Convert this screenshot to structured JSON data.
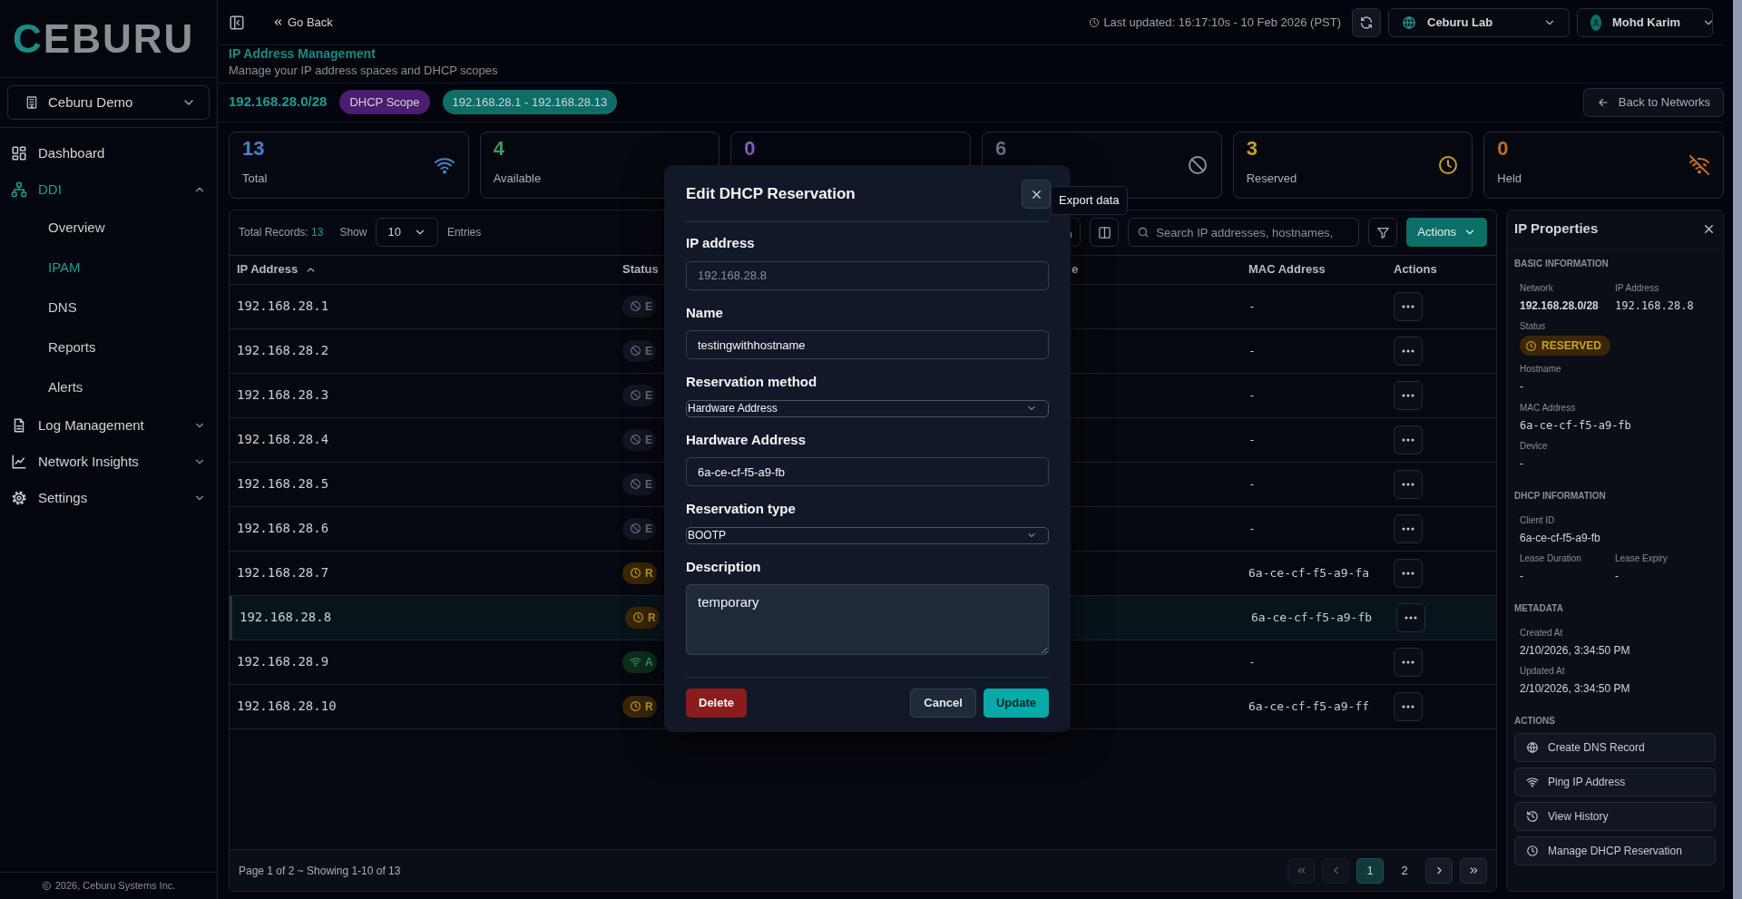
{
  "sidebar": {
    "logo": "CEBURU",
    "workspace": "Ceburu Demo",
    "nav": [
      {
        "kind": "link",
        "label": "Dashboard",
        "selected": false
      },
      {
        "kind": "group",
        "label": "DDI",
        "selected": true,
        "expanded": true,
        "children": [
          {
            "label": "Overview",
            "selected": false
          },
          {
            "label": "IPAM",
            "selected": true
          },
          {
            "label": "DNS",
            "selected": false
          },
          {
            "label": "Reports",
            "selected": false
          },
          {
            "label": "Alerts",
            "selected": false
          }
        ]
      },
      {
        "kind": "group",
        "label": "Log Management",
        "selected": false,
        "expanded": false
      },
      {
        "kind": "group",
        "label": "Network Insights",
        "selected": false,
        "expanded": false
      },
      {
        "kind": "group",
        "label": "Settings",
        "selected": false,
        "expanded": false
      }
    ],
    "footer": "2026, Ceburu Systems Inc."
  },
  "topbar": {
    "back": "Go Back",
    "last_updated": "Last updated: 16:17:10s - 10 Feb 2026 (PST)",
    "org": "Ceburu Lab",
    "user": "Mohd Karim"
  },
  "page": {
    "title": "IP Address Management",
    "subtitle": "Manage your IP address spaces and DHCP scopes"
  },
  "network": {
    "cidr": "192.168.28.0/28",
    "tags": [
      {
        "label": "DHCP Scope",
        "color": "#4a1d6e"
      },
      {
        "label": "192.168.28.1 - 192.168.28.13",
        "color": "#0d6e68"
      }
    ],
    "back_button": "Back to Networks"
  },
  "stats": [
    {
      "value": "13",
      "label": "Total",
      "color": "#4a80c8"
    },
    {
      "value": "4",
      "label": "Available",
      "color": "#3a9a63"
    },
    {
      "value": "0",
      "color": "#8b5cc6"
    },
    {
      "value": "6",
      "color": "#6b7280"
    },
    {
      "value": "3",
      "label": "Reserved",
      "color": "#c9a227"
    },
    {
      "value": "0",
      "label": "Held",
      "color": "#c06a28"
    }
  ],
  "table": {
    "total_label": "Total Records:",
    "total": "13",
    "show_label": "Show",
    "page_size": "10",
    "entries_label": "Entries",
    "search_placeholder": "Search IP addresses, hostnames,",
    "actions_button": "Actions",
    "columns": [
      "IP Address",
      "Status",
      "e",
      "MAC Address",
      "Actions"
    ],
    "rows": [
      {
        "ip": "192.168.28.1",
        "kind": "excluded",
        "status": "E",
        "mac": "-",
        "selected": false
      },
      {
        "ip": "192.168.28.2",
        "kind": "excluded",
        "status": "E",
        "mac": "-",
        "selected": false
      },
      {
        "ip": "192.168.28.3",
        "kind": "excluded",
        "status": "E",
        "mac": "-",
        "selected": false
      },
      {
        "ip": "192.168.28.4",
        "kind": "excluded",
        "status": "E",
        "mac": "-",
        "selected": false
      },
      {
        "ip": "192.168.28.5",
        "kind": "excluded",
        "status": "E",
        "mac": "-",
        "selected": false
      },
      {
        "ip": "192.168.28.6",
        "kind": "excluded",
        "status": "E",
        "mac": "-",
        "selected": false
      },
      {
        "ip": "192.168.28.7",
        "kind": "reserved",
        "status": "R",
        "mac": "6a-ce-cf-f5-a9-fa",
        "selected": false
      },
      {
        "ip": "192.168.28.8",
        "kind": "reserved",
        "status": "R",
        "mac": "6a-ce-cf-f5-a9-fb",
        "selected": true
      },
      {
        "ip": "192.168.28.9",
        "kind": "available",
        "status": "A",
        "mac": "-",
        "selected": false
      },
      {
        "ip": "192.168.28.10",
        "kind": "reserved",
        "status": "R",
        "mac": "6a-ce-cf-f5-a9-ff",
        "selected": false
      }
    ],
    "footer": "Page 1 of 2 ~ Showing 1-10 of 13",
    "pager": [
      {
        "kind": "first",
        "disabled": true,
        "selected": false
      },
      {
        "kind": "prev",
        "disabled": true,
        "selected": false
      },
      {
        "kind": "page",
        "label": "1",
        "disabled": false,
        "selected": true
      },
      {
        "kind": "page",
        "label": "2",
        "disabled": false,
        "selected": false
      },
      {
        "kind": "next",
        "disabled": false,
        "selected": false
      },
      {
        "kind": "last",
        "disabled": false,
        "selected": false
      }
    ]
  },
  "properties": {
    "title": "IP Properties",
    "sections": [
      {
        "heading": "BASIC INFORMATION",
        "rows": [
          [
            {
              "label": "Network",
              "value": "192.168.28.0/28",
              "kind": "bold"
            },
            {
              "label": "IP Address",
              "value": "192.168.28.8",
              "kind": "mono"
            }
          ],
          [
            {
              "label": "Status",
              "value": "RESERVED",
              "kind": "badge"
            }
          ],
          [
            {
              "label": "Hostname",
              "value": "-",
              "kind": "text"
            }
          ],
          [
            {
              "label": "MAC Address",
              "value": "6a-ce-cf-f5-a9-fb",
              "kind": "mono"
            }
          ],
          [
            {
              "label": "Device",
              "value": "-",
              "kind": "text"
            }
          ]
        ]
      },
      {
        "heading": "DHCP INFORMATION",
        "rows": [
          [
            {
              "label": "Client ID",
              "value": "6a-ce-cf-f5-a9-fb",
              "kind": "text"
            }
          ],
          [
            {
              "label": "Lease Duration",
              "value": "-",
              "kind": "text"
            },
            {
              "label": "Lease Expiry",
              "value": "-",
              "kind": "text"
            }
          ]
        ]
      },
      {
        "heading": "METADATA",
        "rows": [
          [
            {
              "label": "Created At",
              "value": "2/10/2026, 3:34:50 PM",
              "kind": "text"
            }
          ],
          [
            {
              "label": "Updated At",
              "value": "2/10/2026, 3:34:50 PM",
              "kind": "text"
            }
          ]
        ]
      }
    ],
    "actions_heading": "ACTIONS",
    "actions": [
      "Create DNS Record",
      "Ping IP Address",
      "View History",
      "Manage DHCP Reservation"
    ]
  },
  "modal": {
    "title": "Edit DHCP Reservation",
    "fields": [
      {
        "kind": "input",
        "label": "IP address",
        "value": "192.168.28.8",
        "disabled": true
      },
      {
        "kind": "input",
        "label": "Name",
        "value": "testingwithhostname",
        "disabled": false
      },
      {
        "kind": "select",
        "label": "Reservation method",
        "value": "Hardware Address",
        "disabled": false
      },
      {
        "kind": "input",
        "label": "Hardware Address",
        "value": "6a-ce-cf-f5-a9-fb",
        "disabled": false
      },
      {
        "kind": "select",
        "label": "Reservation type",
        "value": "BOOTP",
        "disabled": false
      },
      {
        "kind": "textarea",
        "label": "Description",
        "value": "temporary",
        "disabled": false
      }
    ],
    "buttons": [
      {
        "kind": "danger",
        "label": "Delete"
      },
      {
        "kind": "secondary",
        "label": "Cancel"
      },
      {
        "kind": "primary",
        "label": "Update"
      }
    ]
  },
  "tooltip": {
    "text": "Export data"
  }
}
